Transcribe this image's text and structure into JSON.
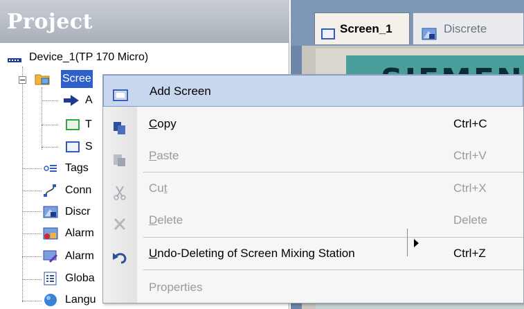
{
  "project_panel": {
    "title": "Project",
    "device_label": "Device_1(TP 170 Micro)",
    "screens_label": "Scree",
    "screen_children": [
      "A",
      "T",
      "S"
    ],
    "items": [
      "Tags",
      "Conn",
      "Discr",
      "Alarm",
      "Alarm",
      "Globa",
      "Langu"
    ]
  },
  "editor": {
    "tabs": [
      {
        "label": "Screen_1",
        "active": true,
        "icon": "screen-icon"
      },
      {
        "label": "Discrete",
        "active": false,
        "icon": "discrete-alarm-icon"
      }
    ],
    "logo_text": "SIEMENS"
  },
  "context_menu": {
    "items": [
      {
        "label": "Add Screen",
        "shortcut": "",
        "enabled": true,
        "highlighted": true,
        "icon": "add-screen-icon"
      },
      {
        "label_underlined": "C",
        "label_rest": "opy",
        "shortcut": "Ctrl+C",
        "enabled": true,
        "icon": "copy-icon"
      },
      {
        "label_underlined": "P",
        "label_rest": "aste",
        "shortcut": "Ctrl+V",
        "enabled": false,
        "icon": "paste-icon"
      },
      {
        "label_pre": "Cu",
        "label_underlined": "t",
        "shortcut": "Ctrl+X",
        "enabled": false,
        "icon": "cut-icon"
      },
      {
        "label_underlined": "D",
        "label_rest": "elete",
        "shortcut": "Delete",
        "enabled": false,
        "icon": "delete-icon"
      },
      {
        "label_underlined": "U",
        "label_rest": "ndo-Deleting of Screen Mixing Station",
        "shortcut": "Ctrl+Z",
        "enabled": true,
        "has_submenu": true,
        "icon": "undo-icon"
      },
      {
        "label": "Properties",
        "shortcut": "",
        "enabled": false,
        "icon": ""
      }
    ]
  },
  "colors": {
    "selection": "#2f5fc9",
    "menu_highlight": "#c8d7ee",
    "header_gradient_top": "#c9ced5",
    "editor_bg": "#6e86a8",
    "banner": "#4a9e9b"
  }
}
